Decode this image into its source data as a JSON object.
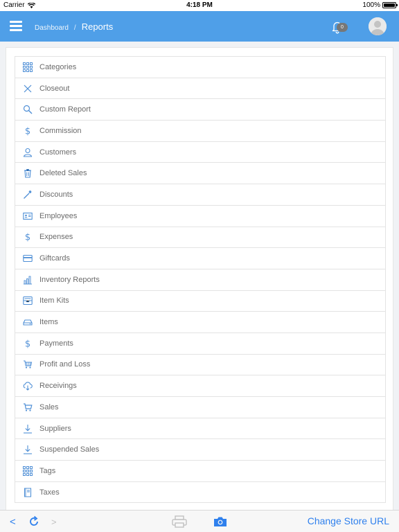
{
  "status_bar": {
    "carrier": "Carrier",
    "time": "4:18 PM",
    "battery": "100%"
  },
  "header": {
    "breadcrumb_parent": "Dashboard",
    "breadcrumb_separator": "/",
    "title": "Reports",
    "notification_count": "0",
    "accent_color": "#4f9fe8"
  },
  "reports": [
    {
      "label": "Categories",
      "icon": "grid-icon"
    },
    {
      "label": "Closeout",
      "icon": "close-icon"
    },
    {
      "label": "Custom Report",
      "icon": "search-icon"
    },
    {
      "label": "Commission",
      "icon": "dollar-icon"
    },
    {
      "label": "Customers",
      "icon": "user-icon"
    },
    {
      "label": "Deleted Sales",
      "icon": "trash-icon"
    },
    {
      "label": "Discounts",
      "icon": "magic-wand-icon"
    },
    {
      "label": "Employees",
      "icon": "id-card-icon"
    },
    {
      "label": "Expenses",
      "icon": "dollar-icon"
    },
    {
      "label": "Giftcards",
      "icon": "credit-card-icon"
    },
    {
      "label": "Inventory Reports",
      "icon": "bar-chart-icon"
    },
    {
      "label": "Item Kits",
      "icon": "inbox-icon"
    },
    {
      "label": "Items",
      "icon": "harddrive-icon"
    },
    {
      "label": "Payments",
      "icon": "dollar-icon"
    },
    {
      "label": "Profit and Loss",
      "icon": "cart-icon"
    },
    {
      "label": "Receivings",
      "icon": "cloud-download-icon"
    },
    {
      "label": "Sales",
      "icon": "shopping-cart-icon"
    },
    {
      "label": "Suppliers",
      "icon": "download-icon"
    },
    {
      "label": "Suspended Sales",
      "icon": "download-icon"
    },
    {
      "label": "Tags",
      "icon": "grid-icon"
    },
    {
      "label": "Taxes",
      "icon": "book-icon"
    }
  ],
  "toolbar": {
    "back": "<",
    "forward": ">",
    "change_store_url": "Change Store URL"
  }
}
